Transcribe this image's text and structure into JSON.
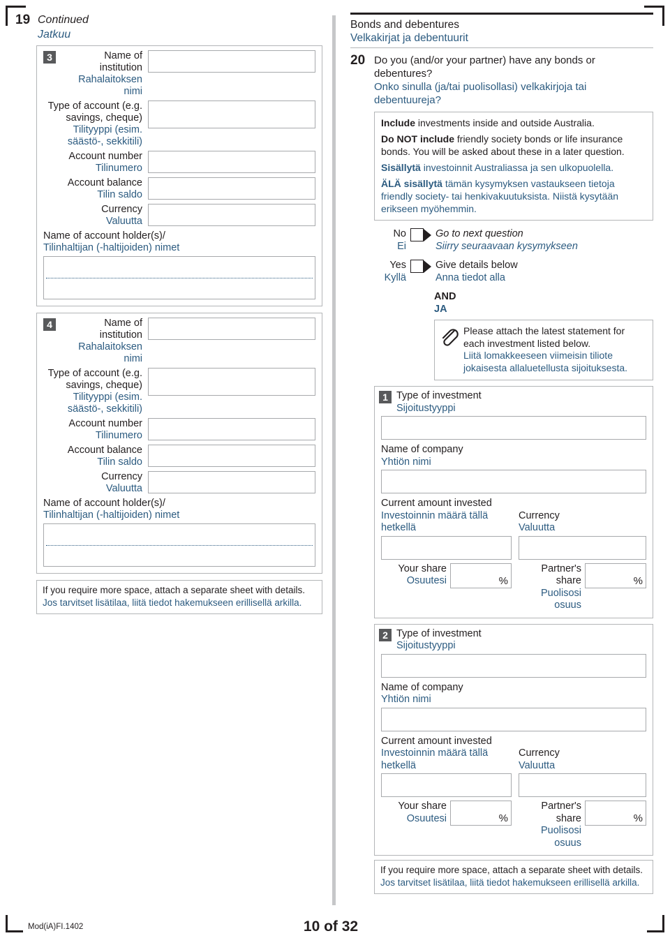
{
  "page": {
    "footer_code": "Mod(iA)FI.1402",
    "page_label": "10 of 32"
  },
  "left_column": {
    "question": {
      "number": "19",
      "title_en": "Continued",
      "title_fi": "Jatkuu"
    },
    "accounts": [
      {
        "badge": "3",
        "institution_en": "Name of institution",
        "institution_fi": "Rahalaitoksen nimi",
        "type_en_line1": "Type of account (e.g.",
        "type_en_line2": "savings, cheque)",
        "type_fi_line1": "Tilityyppi (esim.",
        "type_fi_line2": "säästö-, sekkitili)",
        "number_en": "Account number",
        "number_fi": "Tilinumero",
        "balance_en": "Account balance",
        "balance_fi": "Tilin saldo",
        "currency_en": "Currency",
        "currency_fi": "Valuutta",
        "holder_en": "Name of account holder(s)/",
        "holder_fi": "Tilinhaltijan (-haltijoiden) nimet"
      },
      {
        "badge": "4",
        "institution_en": "Name of institution",
        "institution_fi": "Rahalaitoksen nimi",
        "type_en_line1": "Type of account (e.g.",
        "type_en_line2": "savings, cheque)",
        "type_fi_line1": "Tilityyppi (esim.",
        "type_fi_line2": "säästö-, sekkitili)",
        "number_en": "Account number",
        "number_fi": "Tilinumero",
        "balance_en": "Account balance",
        "balance_fi": "Tilin saldo",
        "currency_en": "Currency",
        "currency_fi": "Valuutta",
        "holder_en": "Name of account holder(s)/",
        "holder_fi": "Tilinhaltijan (-haltijoiden) nimet"
      }
    ],
    "note": {
      "en": "If you require more space, attach a separate sheet with details.",
      "fi": "Jos tarvitset lisätilaa, liitä tiedot hakemukseen erillisellä arkilla."
    }
  },
  "right_column": {
    "section": {
      "title_en": "Bonds and debentures",
      "title_fi": "Velkakirjat ja debentuurit"
    },
    "question": {
      "number": "20",
      "en": "Do you (and/or your partner) have any bonds or debentures?",
      "fi": "Onko sinulla (ja/tai puolisollasi) velkakirjoja tai debentuureja?"
    },
    "info_box": {
      "p1_bold": "Include",
      "p1_rest": " investments inside and outside Australia.",
      "p2_bold": "Do NOT include",
      "p2_rest": " friendly society bonds or life insurance bonds. You will be asked about these in a later question.",
      "p3_bold": "Sisällytä",
      "p3_rest": " investoinnit Australiassa ja sen ulkopuolella.",
      "p4_bold": "ÄLÄ sisällytä",
      "p4_rest": " tämän kysymyksen vastaukseen tietoja friendly society- tai henkivakuutuksista.  Niistä kysytään erikseen myöhemmin."
    },
    "choices": [
      {
        "label_en": "No",
        "label_fi": "Ei",
        "action_en": "Go to next question",
        "action_fi": "Siirry seuraavaan kysymykseen",
        "italic": true
      },
      {
        "label_en": "Yes",
        "label_fi": "Kyllä",
        "action_en": "Give details below",
        "action_fi": "Anna tiedot alla",
        "italic": false
      }
    ],
    "and_label_en": "AND",
    "and_label_fi": "JA",
    "attach_note": {
      "icon": "paperclip-icon",
      "en": "Please attach the latest statement for each investment listed below.",
      "fi": "Liitä lomakkeeseen viimeisin tiliote jokaisesta allaluetellusta sijoituksesta."
    },
    "investments": [
      {
        "badge": "1",
        "type_en": "Type of investment",
        "type_fi": "Sijoitustyyppi",
        "company_en": "Name of company",
        "company_fi": "Yhtiön nimi",
        "amount_en": "Current amount invested",
        "amount_fi": "Investoinnin määrä tällä hetkellä",
        "currency_en": "Currency",
        "currency_fi": "Valuutta",
        "your_share_en": "Your share",
        "your_share_fi": "Osuutesi",
        "partner_share_en": "Partner's share",
        "partner_share_fi": "Puolisosi osuus",
        "percent_sign": "%"
      },
      {
        "badge": "2",
        "type_en": "Type of investment",
        "type_fi": "Sijoitustyyppi",
        "company_en": "Name of company",
        "company_fi": "Yhtiön nimi",
        "amount_en": "Current amount invested",
        "amount_fi": "Investoinnin määrä tällä hetkellä",
        "currency_en": "Currency",
        "currency_fi": "Valuutta",
        "your_share_en": "Your share",
        "your_share_fi": "Osuutesi",
        "partner_share_en": "Partner's share",
        "partner_share_fi": "Puolisosi osuus",
        "percent_sign": "%"
      }
    ],
    "note": {
      "en": "If you require more space, attach a separate sheet with details.",
      "fi": "Jos tarvitset lisätilaa, liitä tiedot hakemukseen erillisellä arkilla."
    }
  }
}
